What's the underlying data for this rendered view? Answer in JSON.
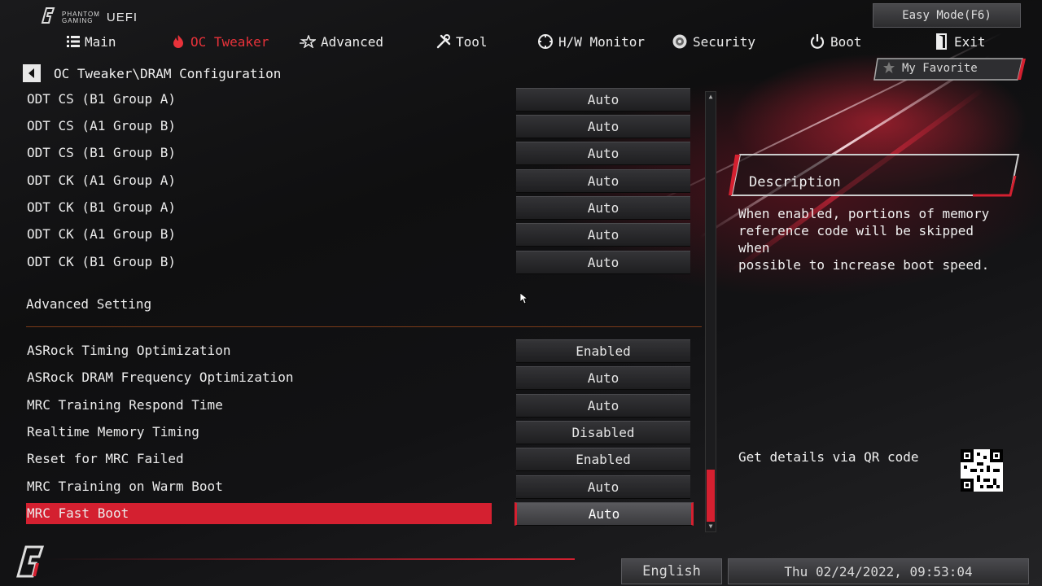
{
  "brand": {
    "logo_line1": "PHANTOM",
    "logo_line2": "GAMING",
    "uefi": "UEFI"
  },
  "header": {
    "easy_mode_label": "Easy Mode(F6)"
  },
  "nav": {
    "items": [
      {
        "label": "Main",
        "icon": "list-icon"
      },
      {
        "label": "OC Tweaker",
        "icon": "flame-icon",
        "active": true
      },
      {
        "label": "Advanced",
        "icon": "star-icon"
      },
      {
        "label": "Tool",
        "icon": "tools-icon"
      },
      {
        "label": "H/W Monitor",
        "icon": "monitor-icon"
      },
      {
        "label": "Security",
        "icon": "shield-icon"
      },
      {
        "label": "Boot",
        "icon": "power-icon"
      },
      {
        "label": "Exit",
        "icon": "exit-door-icon"
      }
    ]
  },
  "breadcrumb": {
    "path": "OC Tweaker\\DRAM Configuration"
  },
  "favorite": {
    "label": "My Favorite"
  },
  "settings_top": [
    {
      "label": "ODT CS (B1 Group A)",
      "value": "Auto"
    },
    {
      "label": "ODT CS (A1 Group B)",
      "value": "Auto"
    },
    {
      "label": "ODT CS (B1 Group B)",
      "value": "Auto"
    },
    {
      "label": "ODT CK (A1 Group A)",
      "value": "Auto"
    },
    {
      "label": "ODT CK (B1 Group A)",
      "value": "Auto"
    },
    {
      "label": "ODT CK (A1 Group B)",
      "value": "Auto"
    },
    {
      "label": "ODT CK (B1 Group B)",
      "value": "Auto"
    }
  ],
  "section": {
    "title": "Advanced Setting"
  },
  "settings_advanced": [
    {
      "label": "ASRock Timing Optimization",
      "value": "Enabled"
    },
    {
      "label": "ASRock DRAM Frequency Optimization",
      "value": "Auto"
    },
    {
      "label": "MRC Training Respond Time",
      "value": "Auto"
    },
    {
      "label": "Realtime Memory Timing",
      "value": "Disabled"
    },
    {
      "label": "Reset for MRC Failed",
      "value": "Enabled"
    },
    {
      "label": "MRC Training on Warm Boot",
      "value": "Auto"
    },
    {
      "label": "MRC Fast Boot",
      "value": "Auto",
      "selected": true
    }
  ],
  "description": {
    "title": "Description",
    "lines": [
      "When enabled, portions of memory",
      "reference code will be skipped when",
      "possible to increase boot speed."
    ]
  },
  "qr": {
    "label": "Get details via QR code"
  },
  "footer": {
    "language": "English",
    "datetime": "Thu 02/24/2022, 09:53:04"
  },
  "colors": {
    "accent": "#d42030",
    "active_nav": "#e8323a"
  }
}
